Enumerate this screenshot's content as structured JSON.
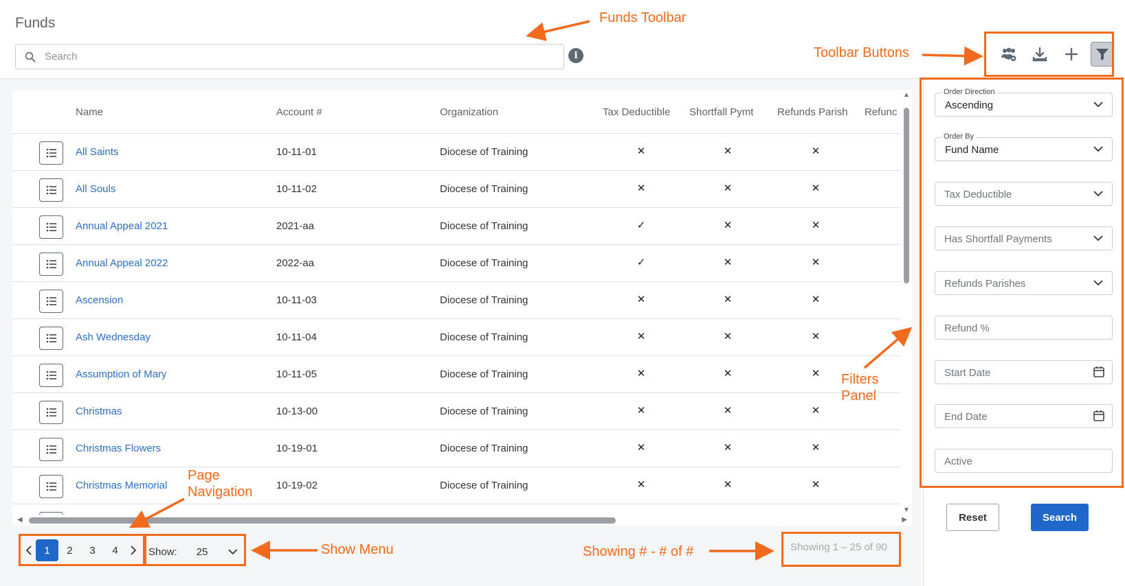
{
  "page": {
    "title": "Funds"
  },
  "search": {
    "placeholder": "Search",
    "info_icon": "i"
  },
  "toolbar": {
    "buttons": [
      "users-settings-icon",
      "download-icon",
      "plus-icon",
      "filter-icon"
    ]
  },
  "table": {
    "columns": [
      "Name",
      "Account #",
      "Organization",
      "Tax Deductible",
      "Shortfall Pymt",
      "Refunds Parish",
      "Refunc"
    ],
    "rows": [
      {
        "name": "All Saints",
        "account": "10-11-01",
        "organization": "Diocese of Training",
        "tax": "✕",
        "shortfall": "✕",
        "refunds": "✕"
      },
      {
        "name": "All Souls",
        "account": "10-11-02",
        "organization": "Diocese of Training",
        "tax": "✕",
        "shortfall": "✕",
        "refunds": "✕"
      },
      {
        "name": "Annual Appeal 2021",
        "account": "2021-aa",
        "organization": "Diocese of Training",
        "tax": "✓",
        "shortfall": "✕",
        "refunds": "✕"
      },
      {
        "name": "Annual Appeal 2022",
        "account": "2022-aa",
        "organization": "Diocese of Training",
        "tax": "✓",
        "shortfall": "✕",
        "refunds": "✕"
      },
      {
        "name": "Ascension",
        "account": "10-11-03",
        "organization": "Diocese of Training",
        "tax": "✕",
        "shortfall": "✕",
        "refunds": "✕"
      },
      {
        "name": "Ash Wednesday",
        "account": "10-11-04",
        "organization": "Diocese of Training",
        "tax": "✕",
        "shortfall": "✕",
        "refunds": "✕"
      },
      {
        "name": "Assumption of Mary",
        "account": "10-11-05",
        "organization": "Diocese of Training",
        "tax": "✕",
        "shortfall": "✕",
        "refunds": "✕"
      },
      {
        "name": "Christmas",
        "account": "10-13-00",
        "organization": "Diocese of Training",
        "tax": "✕",
        "shortfall": "✕",
        "refunds": "✕"
      },
      {
        "name": "Christmas Flowers",
        "account": "10-19-01",
        "organization": "Diocese of Training",
        "tax": "✕",
        "shortfall": "✕",
        "refunds": "✕"
      },
      {
        "name": "Christmas Memorial",
        "account": "10-19-02",
        "organization": "Diocese of Training",
        "tax": "✕",
        "shortfall": "✕",
        "refunds": "✕"
      }
    ]
  },
  "pagination": {
    "pages": [
      "1",
      "2",
      "3",
      "4"
    ],
    "current_page": "1",
    "show_label": "Show:",
    "show_value": "25",
    "showing_text": "Showing 1 – 25 of 90"
  },
  "filters": {
    "order_direction": {
      "label": "Order Direction",
      "value": "Ascending"
    },
    "order_by": {
      "label": "Order By",
      "value": "Fund Name"
    },
    "tax_deductible": "Tax Deductible",
    "has_shortfall": "Has Shortfall Payments",
    "refunds_parishes": "Refunds Parishes",
    "refund_pct": "Refund %",
    "start_date": "Start Date",
    "end_date": "End Date",
    "active": "Active",
    "reset_label": "Reset",
    "search_label": "Search"
  },
  "annotations": {
    "funds_toolbar": "Funds Toolbar",
    "toolbar_buttons": "Toolbar Buttons",
    "filters_panel": "Filters\nPanel",
    "page_navigation": "Page\nNavigation",
    "show_menu": "Show Menu",
    "showing": "Showing # - # of #"
  },
  "colors": {
    "accent": "#1f67c9",
    "link": "#2e6fc0",
    "annotation": "#f26a1b"
  }
}
